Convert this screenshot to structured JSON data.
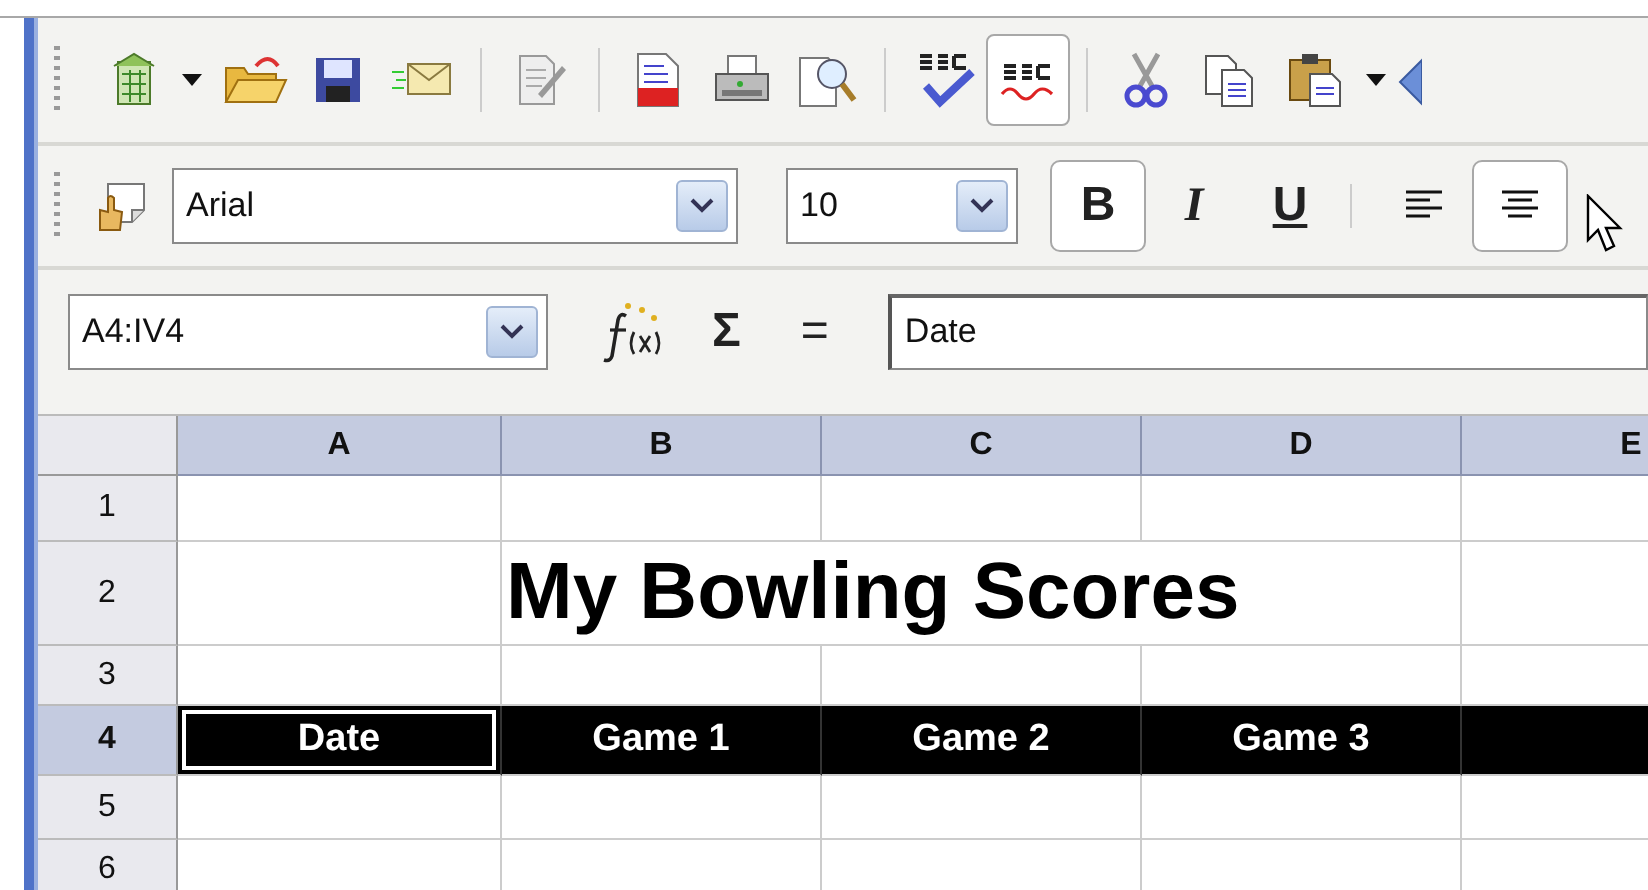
{
  "standard_toolbar": {
    "items": [
      {
        "kind": "new",
        "pressed": false,
        "menu": true
      },
      {
        "kind": "open",
        "pressed": false,
        "menu": false
      },
      {
        "kind": "save",
        "pressed": false,
        "menu": false
      },
      {
        "kind": "mail",
        "pressed": false,
        "menu": false
      },
      {
        "kind": "separator"
      },
      {
        "kind": "edit",
        "pressed": false,
        "menu": false
      },
      {
        "kind": "separator"
      },
      {
        "kind": "pdf",
        "pressed": false,
        "menu": false
      },
      {
        "kind": "print",
        "pressed": false,
        "menu": false
      },
      {
        "kind": "preview",
        "pressed": false,
        "menu": false
      },
      {
        "kind": "separator"
      },
      {
        "kind": "spellcheck",
        "pressed": false,
        "menu": false
      },
      {
        "kind": "autospell",
        "pressed": true,
        "menu": false
      },
      {
        "kind": "separator"
      },
      {
        "kind": "cut",
        "pressed": false,
        "menu": false
      },
      {
        "kind": "copy",
        "pressed": false,
        "menu": false
      },
      {
        "kind": "paste",
        "pressed": false,
        "menu": true
      },
      {
        "kind": "partial",
        "pressed": false,
        "menu": false
      }
    ]
  },
  "formatting_toolbar": {
    "font_name": "Arial",
    "font_size": "10",
    "buttons": [
      {
        "kind": "bold",
        "label": "B",
        "pressed": true
      },
      {
        "kind": "italic",
        "label": "I",
        "pressed": false
      },
      {
        "kind": "underline",
        "label": "U",
        "pressed": false
      },
      {
        "kind": "separator"
      },
      {
        "kind": "align-left",
        "pressed": false
      },
      {
        "kind": "align-center",
        "pressed": true
      }
    ]
  },
  "formula_bar": {
    "name_box": "A4:IV4",
    "sum": "Σ",
    "equals": "=",
    "input": "Date"
  },
  "sheet": {
    "columns": [
      "A",
      "B",
      "C",
      "D",
      "E"
    ],
    "rows": [
      {
        "label": "1",
        "selected": false
      },
      {
        "label": "2",
        "selected": false,
        "kind": "title",
        "title": "My Bowling Scores"
      },
      {
        "label": "3",
        "selected": false
      },
      {
        "label": "4",
        "selected": true,
        "kind": "header",
        "cells": [
          {
            "text": "Date",
            "active": true
          },
          {
            "text": "Game 1",
            "active": false
          },
          {
            "text": "Game 2",
            "active": false
          },
          {
            "text": "Game 3",
            "active": false
          }
        ]
      },
      {
        "label": "5",
        "selected": false
      },
      {
        "label": "6",
        "selected": false
      }
    ]
  }
}
